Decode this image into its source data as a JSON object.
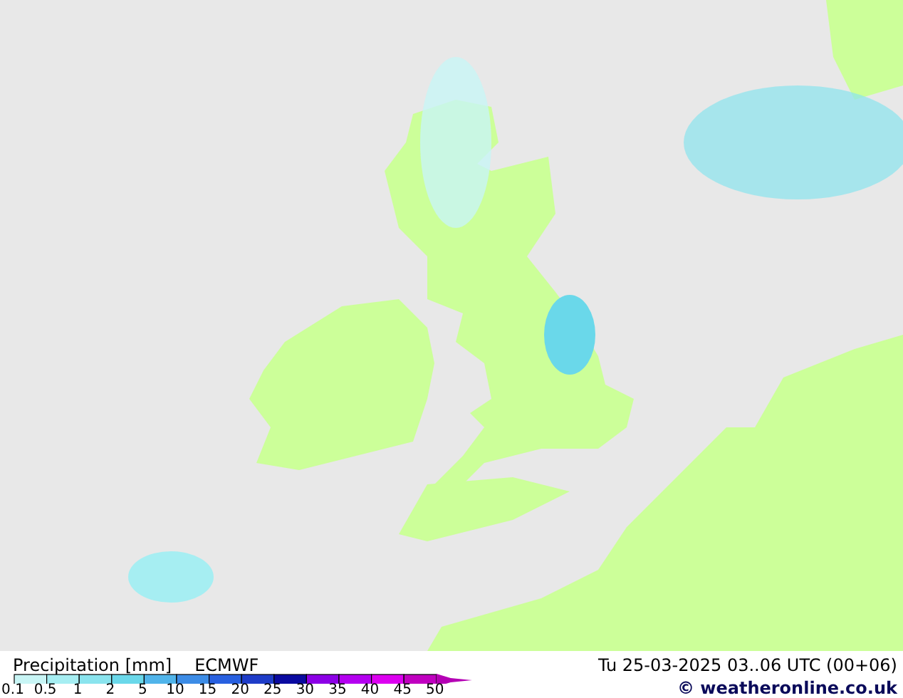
{
  "title": {
    "label": "Precipitation [mm]",
    "model": "ECMWF"
  },
  "valid_time": "Tu 25-03-2025 03..06 UTC (00+06)",
  "legend": {
    "segments": [
      {
        "kind": "box",
        "color": "#c8f5f5"
      },
      {
        "kind": "box",
        "color": "#a6eef2"
      },
      {
        "kind": "box",
        "color": "#8ae4ee"
      },
      {
        "kind": "box",
        "color": "#6ad8ea"
      },
      {
        "kind": "box",
        "color": "#50b4ea"
      },
      {
        "kind": "box",
        "color": "#3c8ce6"
      },
      {
        "kind": "box",
        "color": "#2860e0"
      },
      {
        "kind": "box",
        "color": "#1e3cc8"
      },
      {
        "kind": "box",
        "color": "#0a0aa0"
      },
      {
        "kind": "box",
        "color": "#8c00e6"
      },
      {
        "kind": "box",
        "color": "#b400f0"
      },
      {
        "kind": "box",
        "color": "#dc00f0"
      },
      {
        "kind": "box",
        "color": "#c000c0"
      },
      {
        "kind": "arrow",
        "color": "#b400b4"
      }
    ],
    "ticks": [
      "0.1",
      "0.5",
      "1",
      "2",
      "5",
      "10",
      "15",
      "20",
      "25",
      "30",
      "35",
      "40",
      "45",
      "50"
    ]
  },
  "copyright": "© weatheronline.co.uk"
}
